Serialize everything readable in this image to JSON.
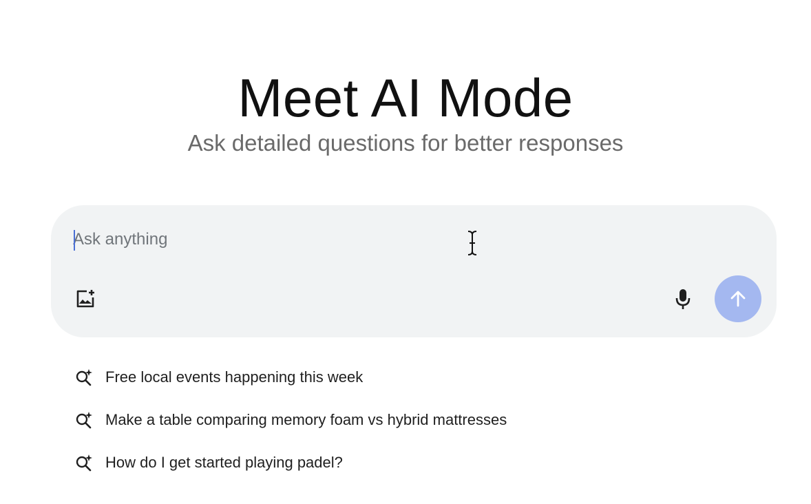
{
  "header": {
    "title": "Meet AI Mode",
    "subtitle": "Ask detailed questions for better responses"
  },
  "search": {
    "placeholder": "Ask anything",
    "value": "",
    "icons": {
      "image_upload": "add-image-icon",
      "microphone": "microphone-icon",
      "send": "arrow-up-icon"
    },
    "send_button_color": "#a4b8f0",
    "box_color": "#f1f3f4"
  },
  "suggestions": [
    {
      "icon": "sparkle-search-icon",
      "label": "Free local events happening this week"
    },
    {
      "icon": "sparkle-search-icon",
      "label": "Make a table comparing memory foam vs hybrid mattresses"
    },
    {
      "icon": "sparkle-search-icon",
      "label": "How do I get started playing padel?"
    }
  ],
  "colors": {
    "title": "#111111",
    "subtitle": "#6a6a6a",
    "caret": "#4a6fd4"
  }
}
